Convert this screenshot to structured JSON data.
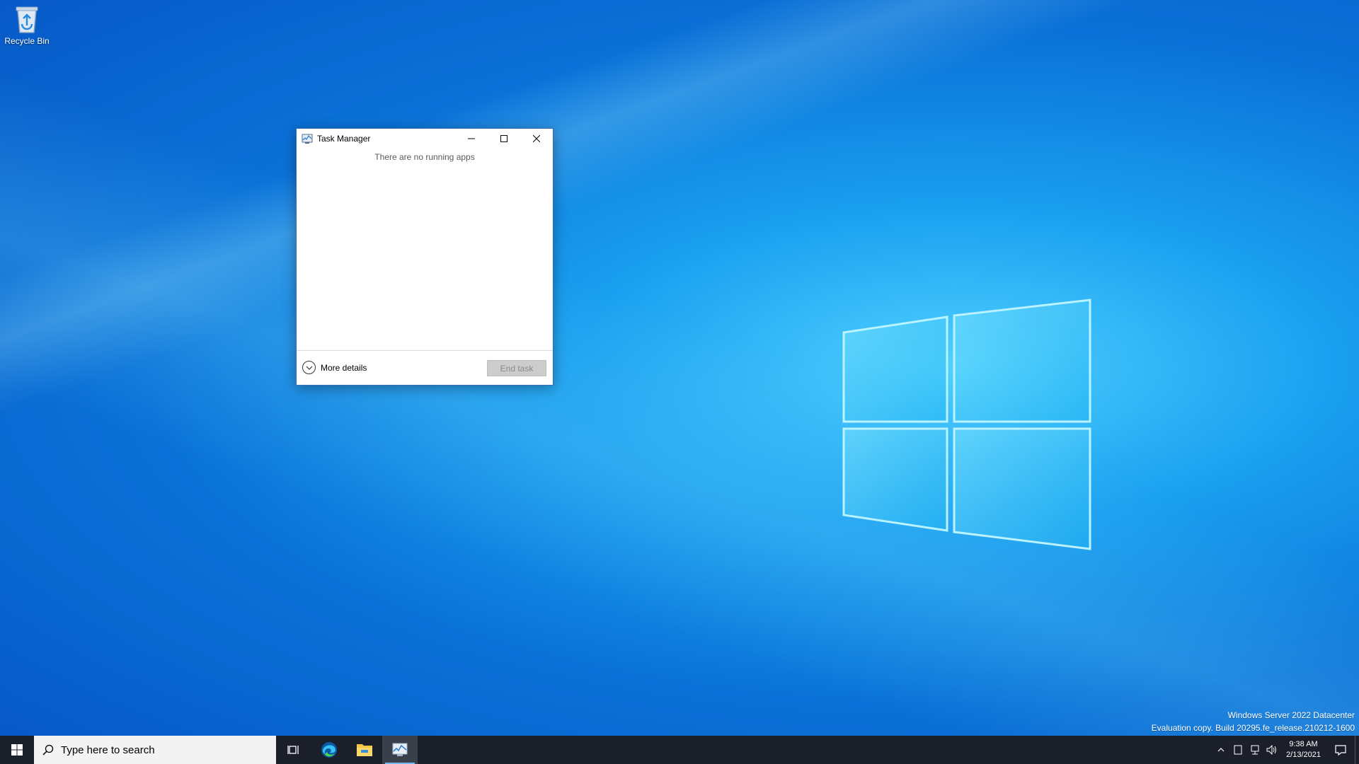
{
  "desktop": {
    "icons": [
      {
        "label": "Recycle Bin",
        "icon": "recycle-bin-icon"
      }
    ]
  },
  "task_manager": {
    "title": "Task Manager",
    "empty_message": "There are no running apps",
    "more_details_label": "More details",
    "end_task_label": "End task"
  },
  "watermark": {
    "line1": "Windows Server 2022 Datacenter",
    "line2": "Evaluation copy. Build 20295.fe_release.210212-1600"
  },
  "taskbar": {
    "search_placeholder": "Type here to search",
    "pinned": [
      "task-view-icon",
      "edge-icon",
      "file-explorer-icon",
      "task-manager-icon"
    ],
    "clock_time": "9:38 AM",
    "clock_date": "2/13/2021"
  },
  "colors": {
    "taskbar_bg": "#1b1f2a",
    "window_border": "#3a6fb3",
    "accent": "#76b9ed"
  }
}
